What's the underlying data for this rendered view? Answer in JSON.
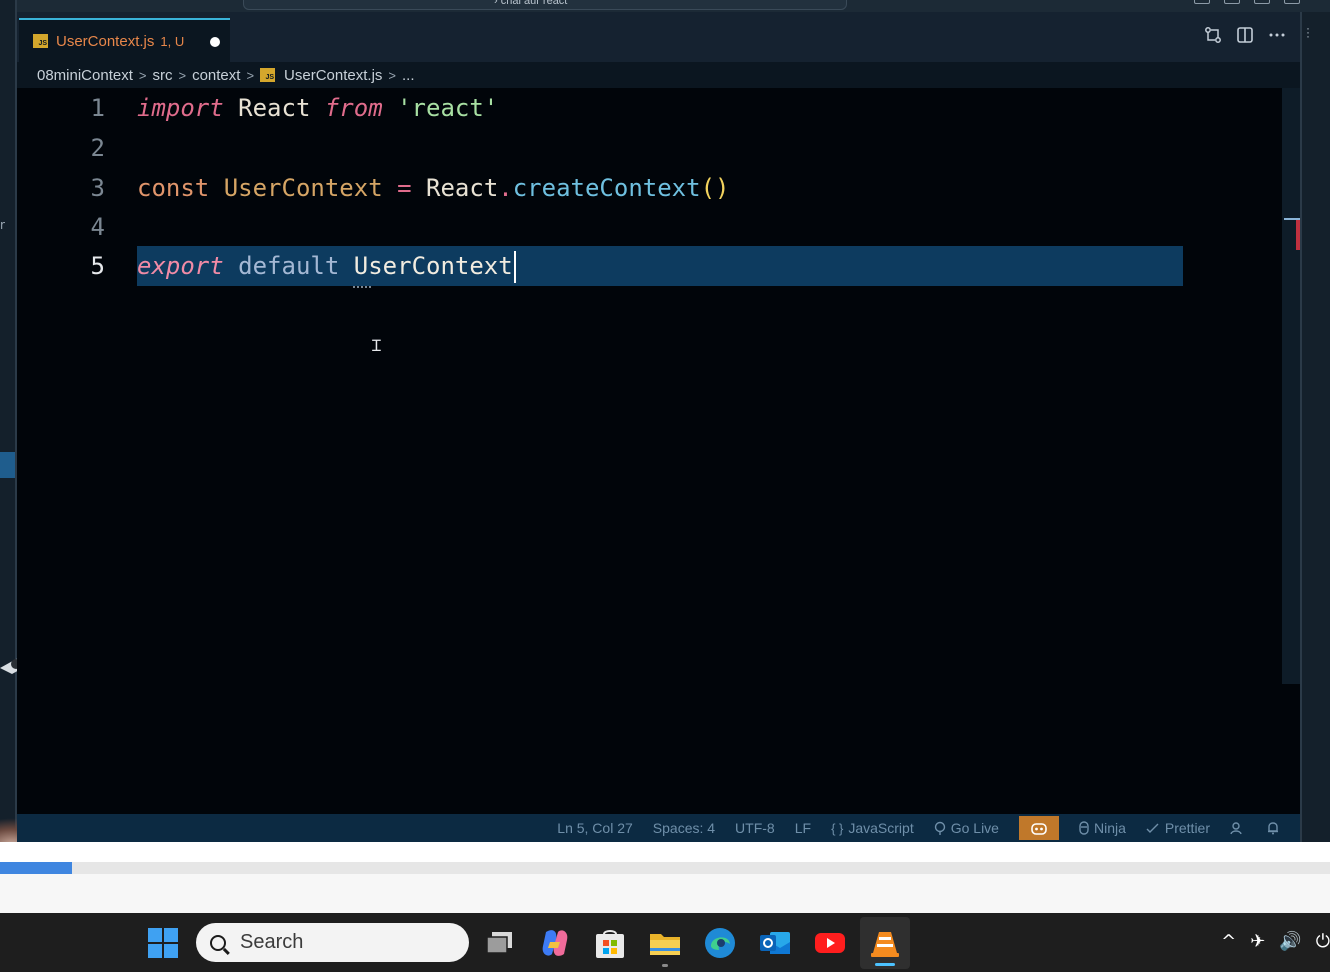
{
  "tab": {
    "filename": "UserContext.js",
    "status": "1, U",
    "icon_text": "JS"
  },
  "breadcrumb": {
    "items": [
      "08miniContext",
      "src",
      "context",
      "UserContext.js",
      "..."
    ],
    "separator": ">"
  },
  "editor": {
    "line_numbers": [
      "1",
      "2",
      "3",
      "4",
      "5"
    ],
    "lines": {
      "l1": {
        "import": "import",
        "react_id": "React",
        "from": "from",
        "module": "'react'"
      },
      "l3": {
        "const": "const",
        "name": "UserContext",
        "eq": "=",
        "obj": "React",
        "dot": ".",
        "fn": "createContext",
        "parens": "()"
      },
      "l5": {
        "export": "export",
        "default": "default",
        "name": "UserContext"
      }
    },
    "cursor_line": 5
  },
  "status_bar": {
    "position": "Ln 5, Col 27",
    "spaces": "Spaces: 4",
    "encoding": "UTF-8",
    "eol": "LF",
    "lang_icon": "{ }",
    "language": "JavaScript",
    "go_live": "Go Live",
    "ninja": "Ninja",
    "prettier": "Prettier"
  },
  "player": {
    "progress": 0.054
  },
  "taskbar": {
    "search_placeholder": "Search"
  },
  "colors": {
    "accent": "#3ab3d9",
    "statusbar_bg": "#0c2a42",
    "selection": "#0d3b5f",
    "progress": "#3f86e0"
  }
}
